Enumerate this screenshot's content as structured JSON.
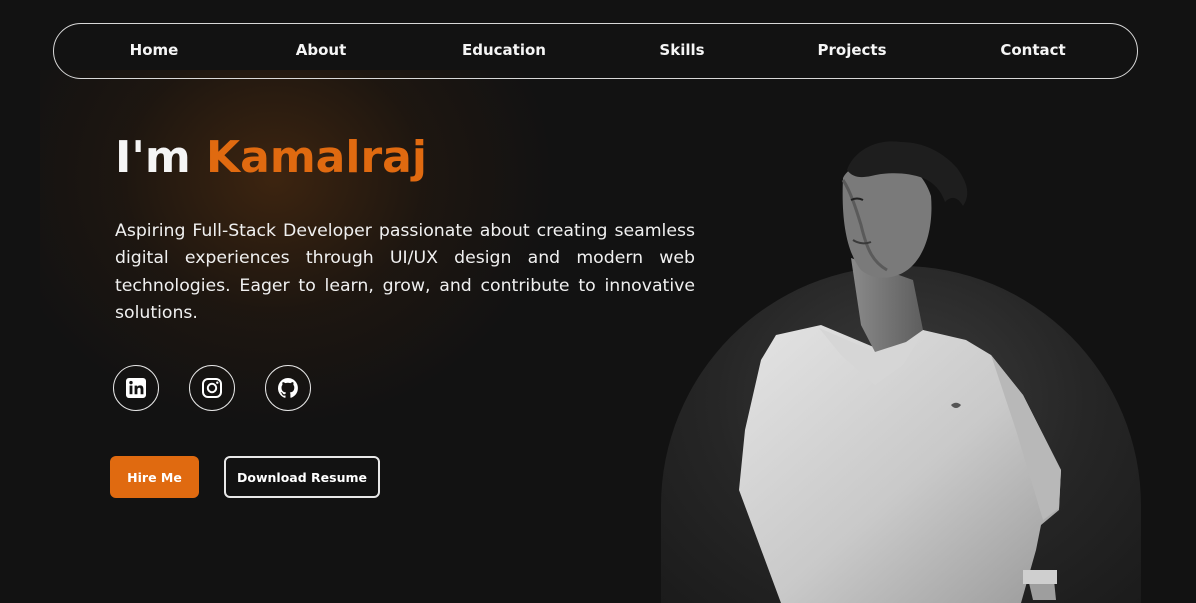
{
  "nav": {
    "items": [
      {
        "label": "Home"
      },
      {
        "label": "About"
      },
      {
        "label": "Education"
      },
      {
        "label": "Skills"
      },
      {
        "label": "Projects"
      },
      {
        "label": "Contact"
      }
    ]
  },
  "hero": {
    "greeting": "I'm",
    "name": "Kamalraj",
    "bio": "Aspiring Full-Stack Developer passionate about creating seamless digital experiences through UI/UX design and modern web technologies. Eager to learn, grow, and contribute to innovative solutions."
  },
  "social": [
    {
      "icon": "linkedin-icon"
    },
    {
      "icon": "instagram-icon"
    },
    {
      "icon": "github-icon"
    }
  ],
  "buttons": {
    "hire": "Hire Me",
    "resume": "Download Resume"
  },
  "colors": {
    "accent": "#e06a10",
    "background": "#121212",
    "text": "#f2f2f2"
  }
}
